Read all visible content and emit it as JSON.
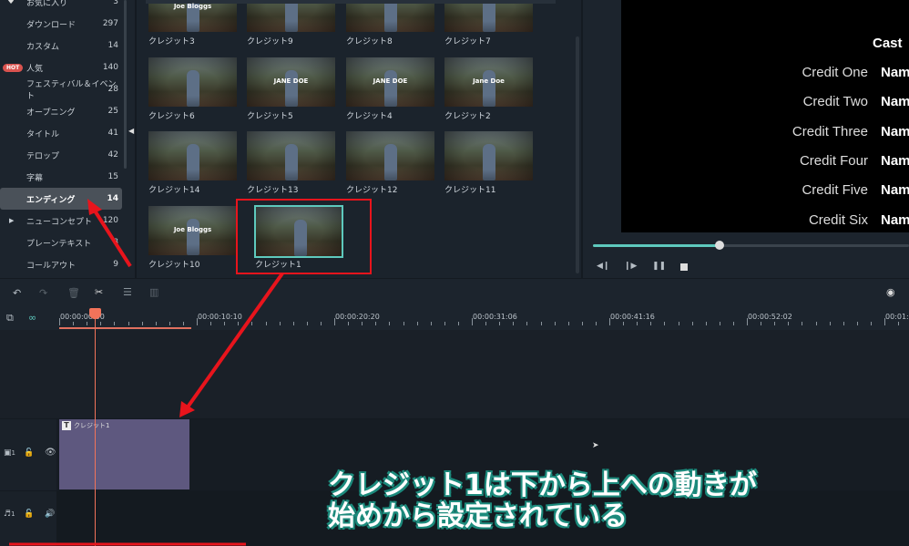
{
  "sidebar": {
    "items": [
      {
        "label": "お気に入り",
        "count": "3"
      },
      {
        "label": "ダウンロード",
        "count": "297"
      },
      {
        "label": "カスタム",
        "count": "14"
      },
      {
        "label": "人気",
        "count": "140",
        "badge": "HOT"
      },
      {
        "label": "フェスティバル＆イベント",
        "count": "28"
      },
      {
        "label": "オープニング",
        "count": "25"
      },
      {
        "label": "タイトル",
        "count": "41"
      },
      {
        "label": "テロップ",
        "count": "42"
      },
      {
        "label": "字幕",
        "count": "15"
      },
      {
        "label": "エンディング",
        "count": "14",
        "selected": true
      },
      {
        "label": "ニューコンセプト",
        "count": "120"
      },
      {
        "label": "プレーンテキスト",
        "count": "8"
      },
      {
        "label": "コールアウト",
        "count": "9"
      }
    ]
  },
  "grid": {
    "items": [
      {
        "label": "クレジット3",
        "text": "Joe Bloggs"
      },
      {
        "label": "クレジット9",
        "text": ""
      },
      {
        "label": "クレジット8",
        "text": ""
      },
      {
        "label": "クレジット7",
        "text": ""
      },
      {
        "label": "クレジット6",
        "text": ""
      },
      {
        "label": "クレジット5",
        "text": "JANE DOE"
      },
      {
        "label": "クレジット4",
        "text": "JANE DOE"
      },
      {
        "label": "クレジット2",
        "text": "Jane Doe"
      },
      {
        "label": "クレジット14",
        "text": ""
      },
      {
        "label": "クレジット13",
        "text": ""
      },
      {
        "label": "クレジット12",
        "text": ""
      },
      {
        "label": "クレジット11",
        "text": ""
      },
      {
        "label": "クレジット10",
        "text": "Joe Bloggs"
      },
      {
        "label": "クレジット1",
        "text": "",
        "selected": true
      }
    ]
  },
  "preview": {
    "heading": "Cast",
    "credits": [
      {
        "role": "Credit One",
        "name": "Nam"
      },
      {
        "role": "Credit Two",
        "name": "Nam"
      },
      {
        "role": "Credit Three",
        "name": "Nam"
      },
      {
        "role": "Credit Four",
        "name": "Nam"
      },
      {
        "role": "Credit Five",
        "name": "Nam"
      },
      {
        "role": "Credit Six",
        "name": "Nam"
      }
    ],
    "progress_percent": 40
  },
  "timeline": {
    "timecodes": [
      "00:00:00:00",
      "00:00:10:10",
      "00:00:20:20",
      "00:00:31:06",
      "00:00:41:16",
      "00:00:52:02",
      "00:01:0"
    ],
    "clip_label": "クレジット1",
    "video_track": "1",
    "audio_track": "1"
  },
  "subtitle": {
    "line1": "クレジット1は下から上への動きが",
    "line2": "始めから設定されている"
  },
  "colors": {
    "accent": "#5ec9bd",
    "playhead": "#f2735a",
    "annotation": "#e8141c",
    "clip": "#5e587f"
  }
}
